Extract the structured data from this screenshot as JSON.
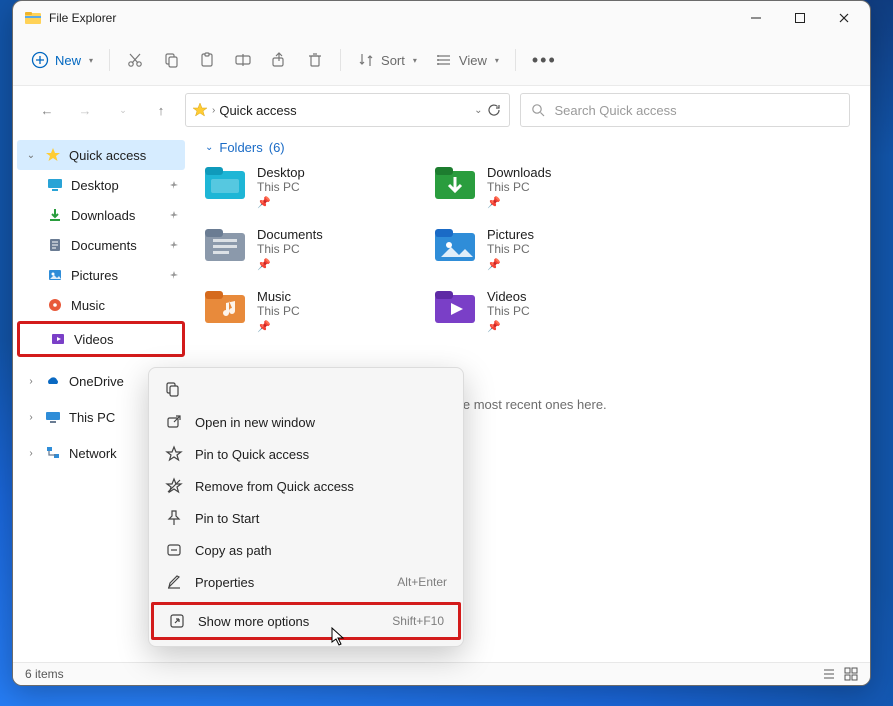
{
  "window": {
    "title": "File Explorer",
    "min": "Minimize",
    "max": "Maximize",
    "close": "Close"
  },
  "toolbar": {
    "new": "New",
    "sort": "Sort",
    "view": "View"
  },
  "breadcrumb": {
    "root": "Quick access"
  },
  "search": {
    "placeholder": "Search Quick access"
  },
  "sidebar": {
    "quick": "Quick access",
    "items": [
      "Desktop",
      "Downloads",
      "Documents",
      "Pictures",
      "Music",
      "Videos"
    ],
    "onedrive": "OneDrive",
    "thispc": "This PC",
    "network": "Network"
  },
  "group": {
    "label": "Folders",
    "count": "(6)"
  },
  "folders": [
    {
      "name": "Desktop",
      "loc": "This PC"
    },
    {
      "name": "Downloads",
      "loc": "This PC"
    },
    {
      "name": "Documents",
      "loc": "This PC"
    },
    {
      "name": "Pictures",
      "loc": "This PC"
    },
    {
      "name": "Music",
      "loc": "This PC"
    },
    {
      "name": "Videos",
      "loc": "This PC"
    }
  ],
  "hint": "After you've opened some files, we'll show the most recent ones here.",
  "status": {
    "count": "6 items"
  },
  "ctx": {
    "open": "Open in new window",
    "pin": "Pin to Quick access",
    "remove": "Remove from Quick access",
    "start": "Pin to Start",
    "copypath": "Copy as path",
    "props": "Properties",
    "props_sc": "Alt+Enter",
    "more": "Show more options",
    "more_sc": "Shift+F10"
  }
}
